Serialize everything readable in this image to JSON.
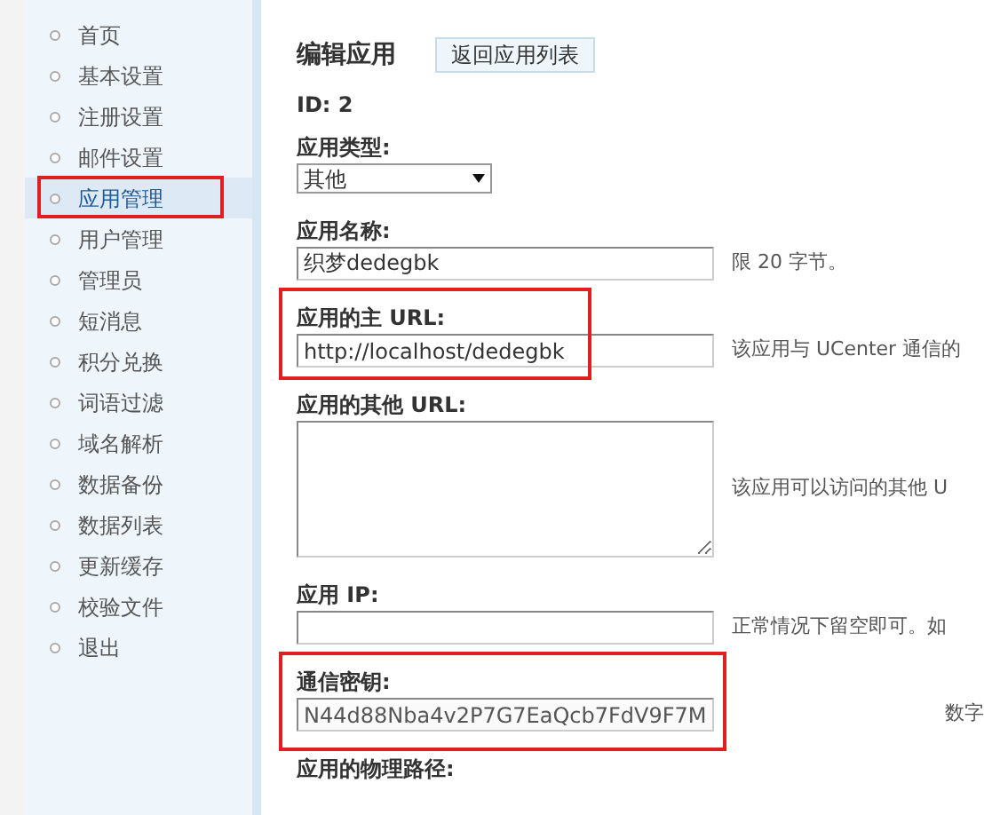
{
  "sidebar": {
    "items": [
      {
        "label": "首页",
        "selected": false
      },
      {
        "label": "基本设置",
        "selected": false
      },
      {
        "label": "注册设置",
        "selected": false
      },
      {
        "label": "邮件设置",
        "selected": false
      },
      {
        "label": "应用管理",
        "selected": true
      },
      {
        "label": "用户管理",
        "selected": false
      },
      {
        "label": "管理员",
        "selected": false
      },
      {
        "label": "短消息",
        "selected": false
      },
      {
        "label": "积分兑换",
        "selected": false
      },
      {
        "label": "词语过滤",
        "selected": false
      },
      {
        "label": "域名解析",
        "selected": false
      },
      {
        "label": "数据备份",
        "selected": false
      },
      {
        "label": "数据列表",
        "selected": false
      },
      {
        "label": "更新缓存",
        "selected": false
      },
      {
        "label": "校验文件",
        "selected": false
      },
      {
        "label": "退出",
        "selected": false
      }
    ]
  },
  "header": {
    "title": "编辑应用",
    "back_button": "返回应用列表"
  },
  "id_line": "ID: 2",
  "fields": [
    {
      "kind": "select",
      "label": "应用类型:",
      "value": "其他"
    },
    {
      "kind": "text",
      "label": "应用名称:",
      "value": "织梦dedegbk",
      "hint": "限 20 字节。"
    },
    {
      "kind": "text",
      "label": "应用的主 URL:",
      "value": "http://localhost/dedegbk",
      "hint": "该应用与 UCenter 通信的",
      "highlighted": true
    },
    {
      "kind": "textarea",
      "label": "应用的其他 URL:",
      "hint": "该应用可以访问的其他 U"
    },
    {
      "kind": "text",
      "label": "应用 IP:",
      "hint": "正常情况下留空即可。如"
    },
    {
      "kind": "key",
      "label": "通信密钥:",
      "value": "N44d88Nba4v2P7G7EaQcb7FdV9F7M",
      "hint": "数字",
      "highlighted": true
    },
    {
      "kind": "label",
      "label": "应用的物理路径:"
    }
  ]
}
